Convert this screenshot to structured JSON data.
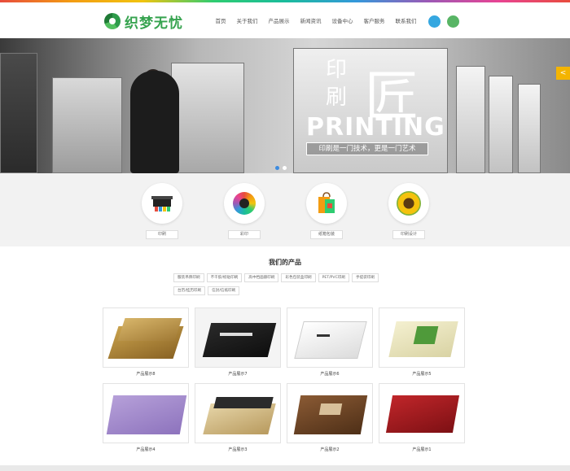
{
  "header": {
    "logo_text": "织梦无忧",
    "nav": [
      "首页",
      "关于我们",
      "产品展示",
      "新闻资讯",
      "设备中心",
      "客户服务",
      "联系我们"
    ]
  },
  "hero": {
    "cn_small_1": "印",
    "cn_small_2": "刷",
    "cn_big": "匠",
    "printing": "PRINTING",
    "slogan": "印刷是一门技术，更是一门艺术",
    "side_tab": "<"
  },
  "services": [
    {
      "label": "印刷",
      "icon": "printer-icon"
    },
    {
      "label": "彩印",
      "icon": "color-wheel-icon"
    },
    {
      "label": "纸箱包装",
      "icon": "bag-icon"
    },
    {
      "label": "印刷设计",
      "icon": "sunflower-icon"
    }
  ],
  "products": {
    "title": "我们的产品",
    "tags": [
      "服装吊牌印刷",
      "不干胶/标贴印刷",
      "高中档画册印刷",
      "彩色包装盒印刷",
      "PET/PVC印刷",
      "手提袋印刷",
      "台历/挂历印刷",
      "信封/信纸印刷"
    ],
    "items": [
      {
        "name": "产品展示8"
      },
      {
        "name": "产品展示7"
      },
      {
        "name": "产品展示6"
      },
      {
        "name": "产品展示5"
      },
      {
        "name": "产品展示4"
      },
      {
        "name": "产品展示3"
      },
      {
        "name": "产品展示2"
      },
      {
        "name": "产品展示1"
      }
    ]
  },
  "colors": {
    "brand_green": "#36a34f",
    "accent_blue": "#35a7e0",
    "accent_yellow": "#f4b400"
  }
}
